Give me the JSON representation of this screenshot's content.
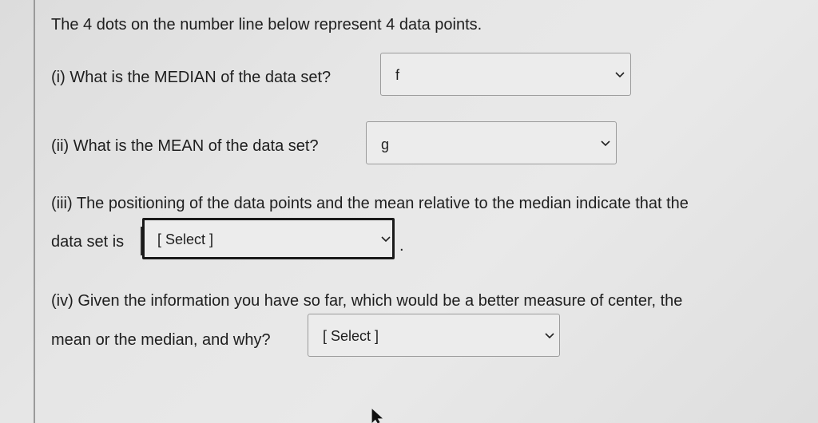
{
  "intro": "The 4 dots on the number line below represent 4 data points.",
  "q1": {
    "label": "(i) What is the MEDIAN of the data set?",
    "value": "f"
  },
  "q2": {
    "label": "(ii) What is the MEAN of the data set?",
    "value": "g"
  },
  "q3": {
    "line1": "(iii) The positioning of the data points and the mean relative to the median indicate that the",
    "line2": "data set is",
    "value": "[ Select ]",
    "after": "."
  },
  "q4": {
    "line1": "(iv) Given the information you have so far, which would be a better measure of center, the",
    "line2": "mean or the median, and why?",
    "value": "[ Select ]"
  },
  "icons": {
    "dropdown": "chevron-down-icon",
    "cursor": "mouse-pointer-icon"
  },
  "colors": {
    "background": "#e4e4e4",
    "text": "#1e1e1e",
    "select_border": "#9b9b9b",
    "focus_border": "#1a1a1a"
  }
}
